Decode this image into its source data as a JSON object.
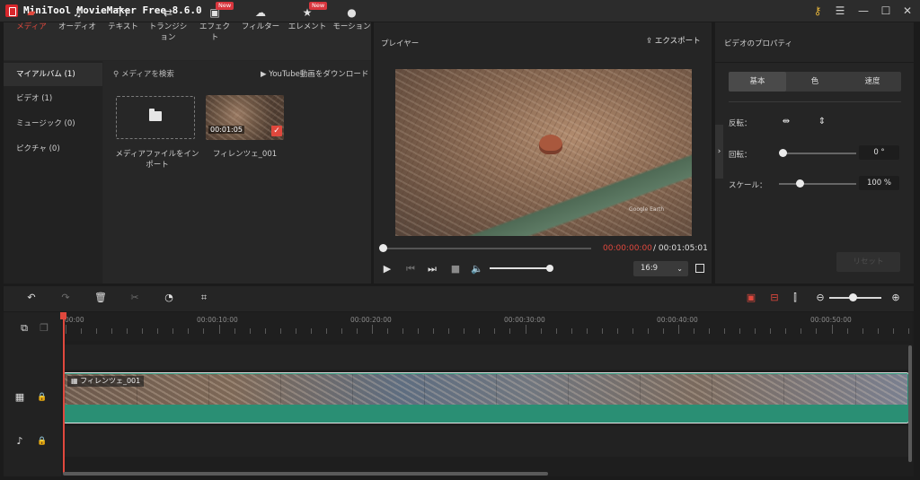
{
  "app": {
    "title": "MiniTool MovieMaker Free 8.6.0",
    "window_controls": [
      "key-icon",
      "menu-icon",
      "minimize-icon",
      "maximize-icon",
      "close-icon"
    ]
  },
  "toolbar": {
    "tabs": [
      {
        "label": "メディア",
        "icon": "folder-icon",
        "active": true
      },
      {
        "label": "オーディオ",
        "icon": "music-note-icon"
      },
      {
        "label": "テキスト",
        "icon": "text-icon"
      },
      {
        "label": "トランジション",
        "icon": "transition-icon"
      },
      {
        "label": "エフェクト",
        "icon": "effect-icon",
        "badge": "New"
      },
      {
        "label": "フィルター",
        "icon": "filter-icon"
      },
      {
        "label": "エレメント",
        "icon": "element-icon",
        "badge": "New"
      },
      {
        "label": "モーション",
        "icon": "motion-icon"
      }
    ]
  },
  "sidebar": {
    "items": [
      {
        "label": "マイアルバム (1)",
        "active": true
      },
      {
        "label": "ビデオ (1)"
      },
      {
        "label": "ミュージック (0)"
      },
      {
        "label": "ピクチャ (0)"
      }
    ]
  },
  "media": {
    "search": "メディアを検索",
    "youtube": "YouTube動画をダウンロード",
    "import_label": "メディアファイルをインポート",
    "clip": {
      "name": "フィレンツェ_001",
      "duration": "00:01:05"
    }
  },
  "player": {
    "title": "プレイヤー",
    "export": "エクスポート",
    "time_current": "00:00:00:00",
    "time_total": "/ 00:01:05:01",
    "progress": 0,
    "volume": 1.0,
    "aspect_ratio": "16:9",
    "watermark": "Google Earth"
  },
  "properties": {
    "title": "ビデオのプロパティ",
    "tabs": [
      "基本",
      "色",
      "速度"
    ],
    "active_tab": "基本",
    "flip_label": "反転：",
    "rotate_label": "回転：",
    "rotate_value": "0 °",
    "scale_label": "スケール：",
    "scale_value": "100 %",
    "reset": "リセット"
  },
  "timeline": {
    "ruler_labels": [
      "00:00",
      "00:00:10:00",
      "00:00:20:00",
      "00:00:30:00",
      "00:00:40:00",
      "00:00:50:00"
    ],
    "clip_name": "フィレンツェ_001"
  },
  "colors": {
    "accent": "#e0483d",
    "audio_bar": "#2a8f74"
  }
}
